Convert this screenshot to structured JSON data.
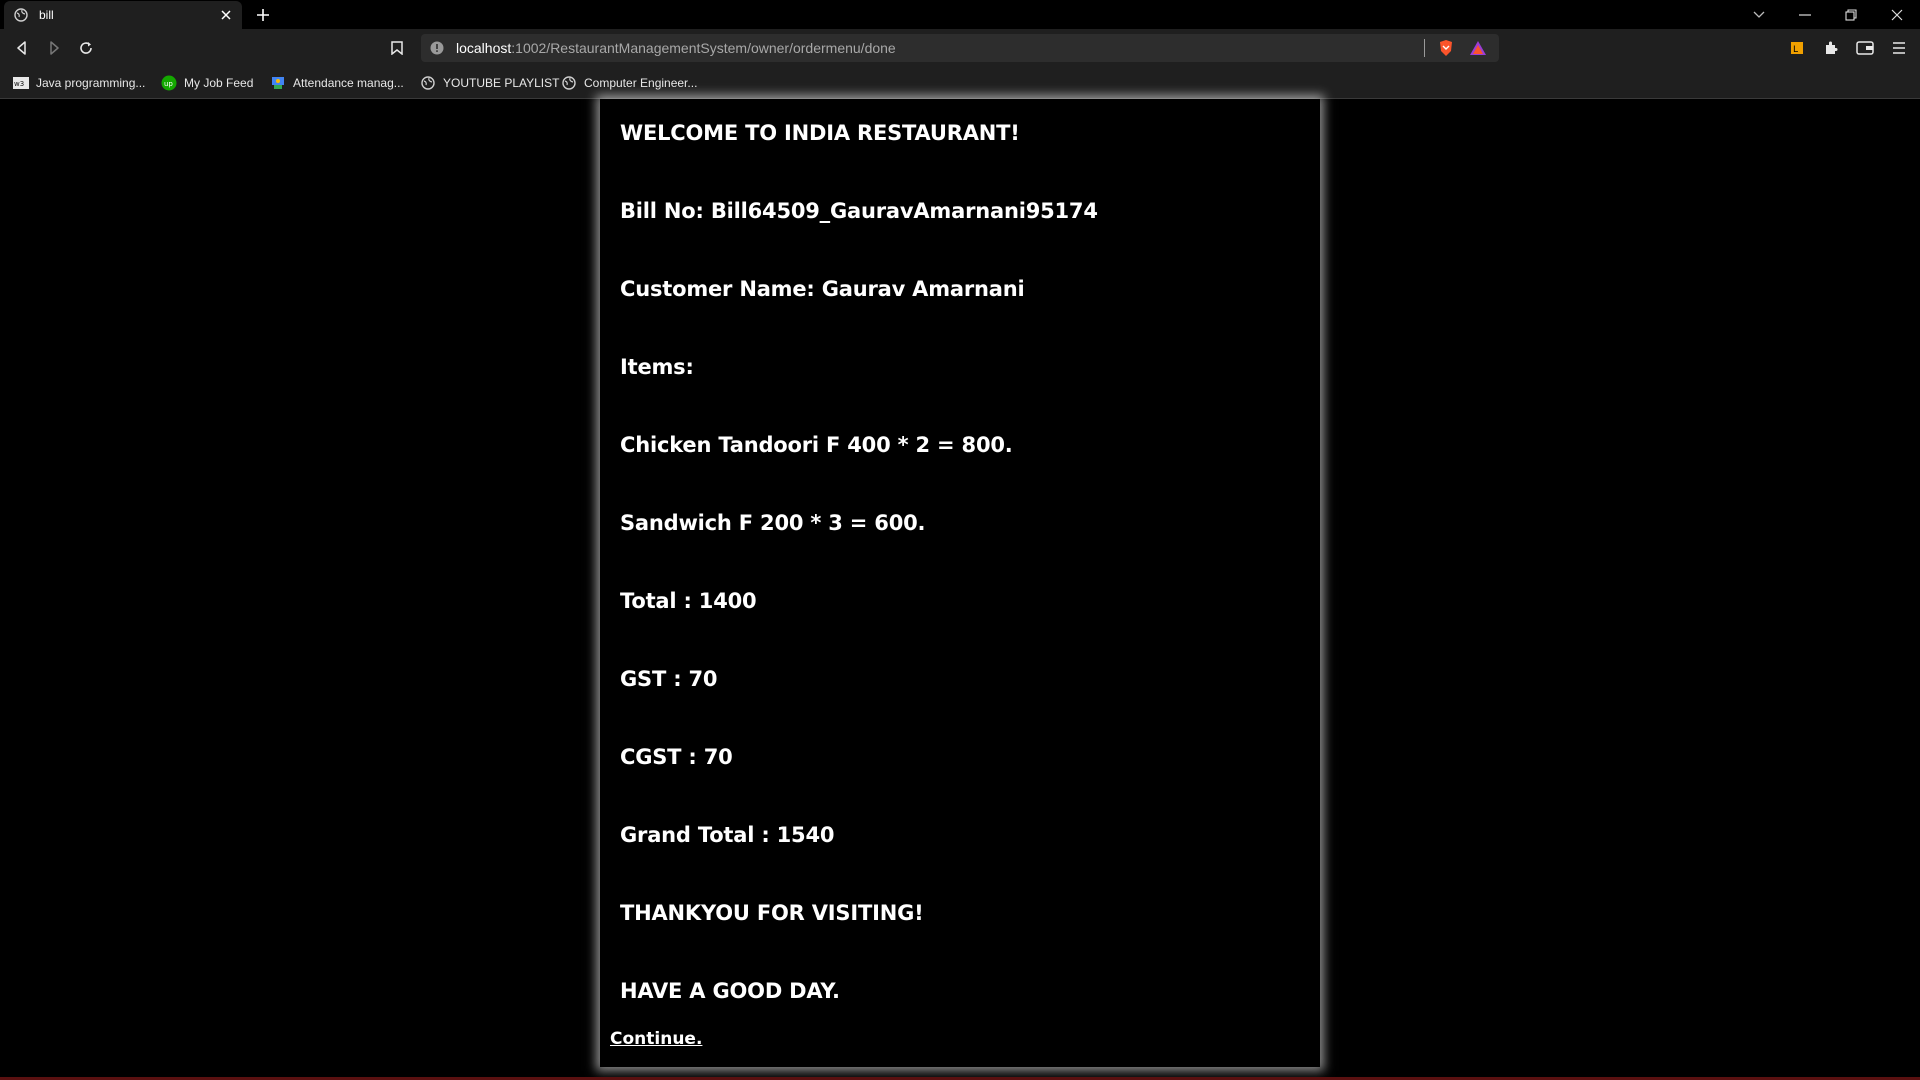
{
  "browser": {
    "tab": {
      "title": "bill",
      "favicon": "globe-icon"
    },
    "address_bar": {
      "host": "localhost",
      "path": ":1002/RestaurantManagementSystem/owner/ordermenu/done"
    },
    "bookmarks": [
      {
        "label": "Java programming...",
        "icon": "w3-icon"
      },
      {
        "label": "My Job Feed",
        "icon": "upwork-icon"
      },
      {
        "label": "Attendance manag...",
        "icon": "attendance-icon"
      },
      {
        "label": "YOUTUBE PLAYLIST",
        "icon": "globe-icon"
      },
      {
        "label": "Computer Engineer...",
        "icon": "globe-icon"
      }
    ],
    "colors": {
      "chrome": "#1f1f1f",
      "omnibox": "#2d2d2d",
      "brave_orange": "#fb542b"
    }
  },
  "bill": {
    "welcome": "WELCOME TO INDIA RESTAURANT!",
    "bill_no": "Bill No: Bill64509_GauravAmarnani95174",
    "customer": "Customer Name: Gaurav Amarnani",
    "items_heading": "Items:",
    "items": [
      "Chicken Tandoori F 400 * 2 = 800.",
      "Sandwich F 200 * 3 = 600."
    ],
    "total": "Total : 1400",
    "gst": "GST : 70",
    "cgst": "CGST : 70",
    "grand_total": "Grand Total : 1540",
    "thanks": "THANKYOU FOR VISITING!",
    "goodbye": "HAVE A GOOD DAY.",
    "continue_label": "Continue."
  }
}
